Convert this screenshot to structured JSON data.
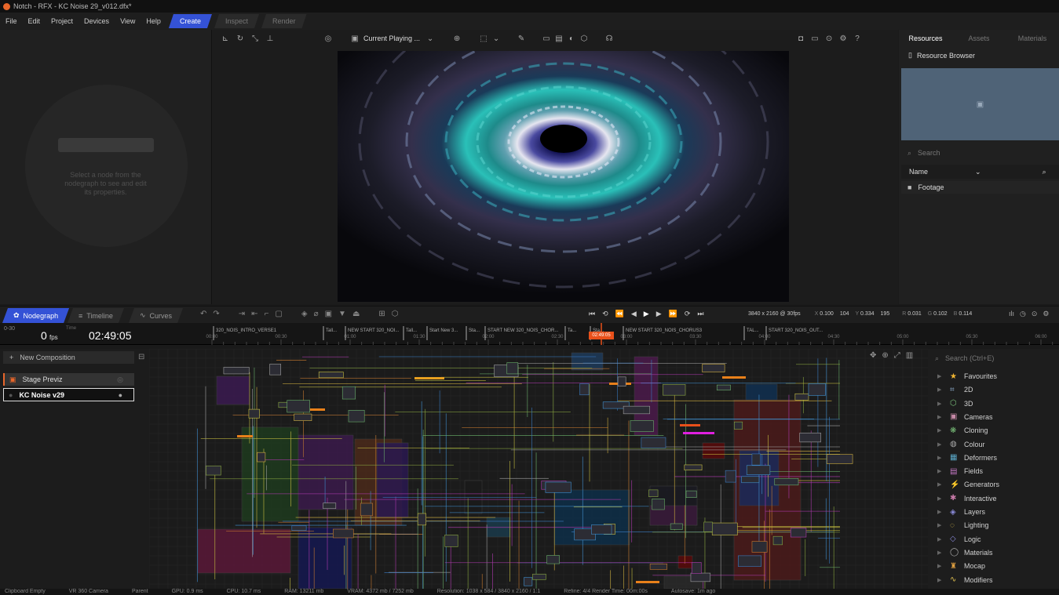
{
  "window": {
    "title": "Notch - RFX - KC Noise 29_v012.dfx*"
  },
  "menu": {
    "items": [
      "File",
      "Edit",
      "Project",
      "Devices",
      "View",
      "Help"
    ],
    "modes": [
      "Create",
      "Inspect",
      "Render"
    ]
  },
  "properties_panel": {
    "hint": "Select a node from the nodegraph to see and edit its properties."
  },
  "viewport": {
    "current_playing": "Current Playing ..."
  },
  "resources": {
    "tabs": [
      "Resources",
      "Assets",
      "Materials"
    ],
    "browser_title": "Resource Browser",
    "search_placeholder": "Search",
    "sort_label": "Name",
    "folder": "Footage"
  },
  "bottom_tabs": [
    "Nodegraph",
    "Timeline",
    "Curves"
  ],
  "transport": {
    "resolution": "3840 x 2160 @ 30fps",
    "x_label": "X",
    "x_value": "0.100",
    "x_px": "104",
    "y_label": "Y",
    "y_value": "0.334",
    "y_px": "195",
    "r_label": "R",
    "r_value": "0.031",
    "g_label": "G",
    "g_value": "0.102",
    "b_label": "B",
    "b_value": "0.114"
  },
  "timeline": {
    "range": "0-30",
    "fps_value": "0",
    "fps_unit": "fps",
    "time_label": "Time",
    "time": "02:49:05",
    "playhead": "02:49:05",
    "ticks": [
      "00:00",
      "00:30",
      "01:00",
      "01:30",
      "02:00",
      "02:30",
      "03:00",
      "03:30",
      "04:00",
      "04:30",
      "05:00",
      "05:30",
      "06:00"
    ],
    "markers": [
      "320_NOIS_INTRO_VERSE1",
      "Tall...",
      "NEW START 320_NOI...",
      "Tall...",
      "Start New 3...",
      "Sta...",
      "START NEW 320_NOIS_CHOR...",
      "Ta...",
      "Sta...",
      "NEW START 320_NOIS_CHORUS3",
      "TAL...",
      "START 320_NOIS_OUT..."
    ]
  },
  "compositions": {
    "new_label": "New Composition",
    "items": [
      "Stage Previz",
      "KC Noise v29"
    ]
  },
  "library": {
    "search_placeholder": "Search (Ctrl+E)",
    "categories": [
      {
        "label": "Favourites",
        "icon": "star-icon",
        "color": "#f2b632"
      },
      {
        "label": "2D",
        "icon": "square-icon",
        "color": "#8aa8c8"
      },
      {
        "label": "3D",
        "icon": "cube-icon",
        "color": "#7ac07a"
      },
      {
        "label": "Cameras",
        "icon": "camera-icon",
        "color": "#c88aa8"
      },
      {
        "label": "Cloning",
        "icon": "cloning-icon",
        "color": "#7ac07a"
      },
      {
        "label": "Colour",
        "icon": "palette-icon",
        "color": "#aaaaaa"
      },
      {
        "label": "Deformers",
        "icon": "grid-icon",
        "color": "#5aa8c8"
      },
      {
        "label": "Fields",
        "icon": "fields-icon",
        "color": "#c87ac8"
      },
      {
        "label": "Generators",
        "icon": "bolt-icon",
        "color": "#8a8ad8"
      },
      {
        "label": "Interactive",
        "icon": "interactive-icon",
        "color": "#c87aa8"
      },
      {
        "label": "Layers",
        "icon": "layers-icon",
        "color": "#8a8ad8"
      },
      {
        "label": "Lighting",
        "icon": "bulb-icon",
        "color": "#e0c050"
      },
      {
        "label": "Logic",
        "icon": "logic-icon",
        "color": "#8a8ad8"
      },
      {
        "label": "Materials",
        "icon": "material-icon",
        "color": "#aaaaaa"
      },
      {
        "label": "Mocap",
        "icon": "figure-icon",
        "color": "#e0a040"
      },
      {
        "label": "Modifiers",
        "icon": "modifiers-icon",
        "color": "#e0c050"
      }
    ]
  },
  "status": {
    "items": [
      "Clipboard Empty",
      "VR 360 Camera",
      "Parent",
      "GPU: 0.9 ms",
      "CPU: 10.7 ms",
      "RAM: 13211 mb",
      "VRAM: 4372 mb / 7252 mb",
      "Resolution: 1038 x 584 / 3840 x 2160 / 1:1",
      "Refine: 4/4  Render Time: 00m:00s",
      "Autosave: 1m ago"
    ]
  }
}
